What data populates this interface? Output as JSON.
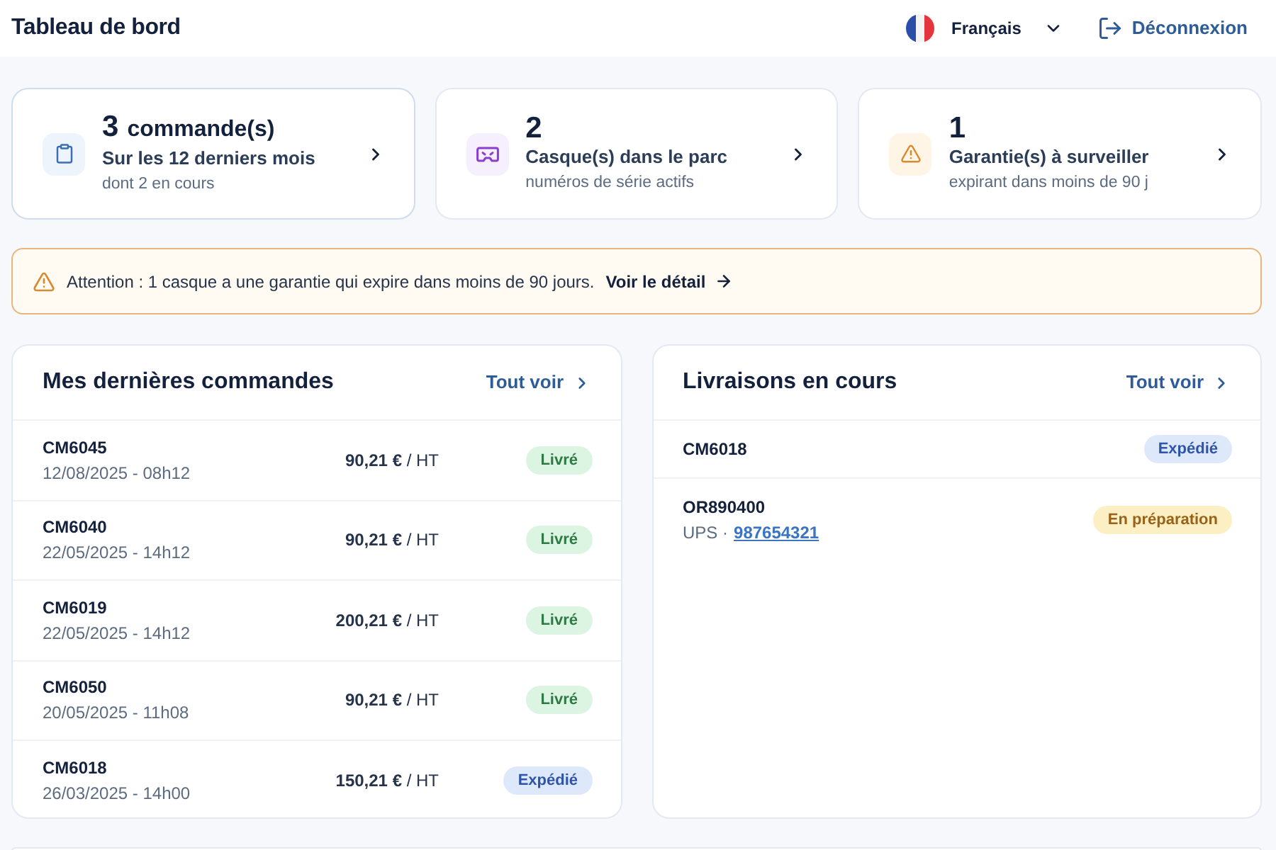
{
  "header": {
    "title": "Tableau de bord",
    "language": "Français",
    "logout": "Déconnexion"
  },
  "stats": [
    {
      "kind": "orders",
      "value": "3",
      "unit": "commande(s)",
      "title": "Sur les 12 derniers mois",
      "subtitle": "dont 2 en cours"
    },
    {
      "kind": "headsets",
      "value": "2",
      "title": "Casque(s) dans le parc",
      "subtitle": "numéros de série actifs"
    },
    {
      "kind": "warranty",
      "value": "1",
      "title": "Garantie(s) à surveiller",
      "subtitle": "expirant dans moins de 90 j"
    }
  ],
  "alert": {
    "text": "Attention : 1 casque a une garantie qui expire dans moins de 90 jours.",
    "link": "Voir le détail"
  },
  "orders": {
    "title": "Mes dernières commandes",
    "link": "Tout voir",
    "rows": [
      {
        "id": "CM6045",
        "date": "12/08/2025 - 08h12",
        "amount": "**90,21 €** / HT",
        "status": {
          "label": "Livré",
          "kind": "delivered"
        }
      },
      {
        "id": "CM6040",
        "date": "22/05/2025 - 14h12",
        "amount": "**90,21 €** / HT",
        "status": {
          "label": "Livré",
          "kind": "delivered"
        }
      },
      {
        "id": "CM6019",
        "date": "22/05/2025 - 14h12",
        "amount": "**200,21 €** / HT",
        "status": {
          "label": "Livré",
          "kind": "delivered"
        }
      },
      {
        "id": "CM6050",
        "date": "20/05/2025 - 11h08",
        "amount": "**90,21 €** / HT",
        "status": {
          "label": "Livré",
          "kind": "delivered"
        }
      },
      {
        "id": "CM6018",
        "date": "26/03/2025 - 14h00",
        "amount": "**150,21 €** / HT",
        "status": {
          "label": "Expédié",
          "kind": "shipped"
        }
      }
    ]
  },
  "deliveries": {
    "title": "Livraisons en cours",
    "link": "Tout voir",
    "rows": [
      {
        "id": "CM6018",
        "status": {
          "label": "Expédié",
          "kind": "shipped"
        }
      },
      {
        "id": "OR890400",
        "carrier": "UPS ·",
        "tracking": "987654321",
        "status": {
          "label": "En préparation",
          "kind": "preparing"
        }
      }
    ]
  }
}
